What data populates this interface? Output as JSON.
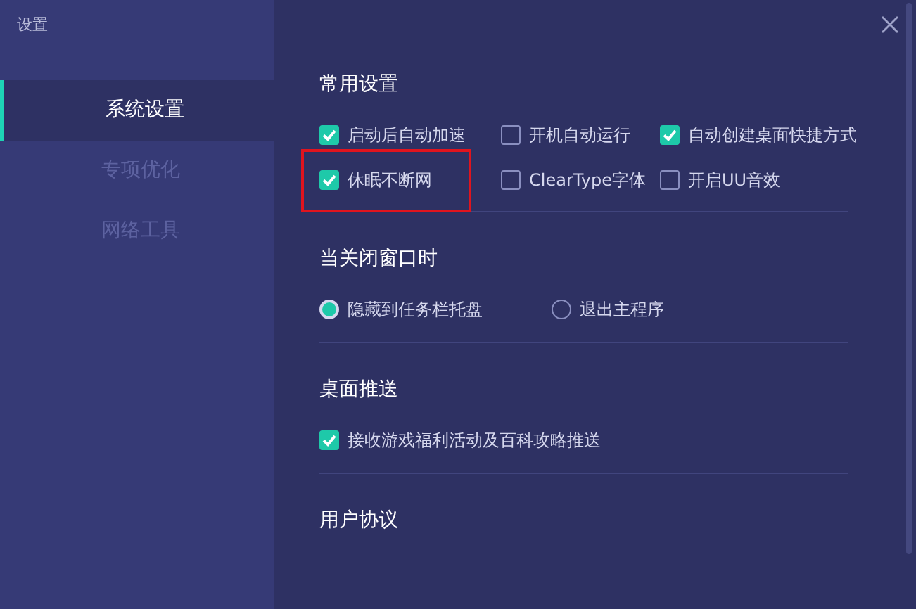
{
  "window": {
    "title": "设置"
  },
  "sidebar": {
    "items": [
      {
        "label": "系统设置",
        "selected": true
      },
      {
        "label": "专项优化",
        "selected": false
      },
      {
        "label": "网络工具",
        "selected": false
      }
    ]
  },
  "sections": [
    {
      "title": "常用设置",
      "kind": "checkboxes",
      "options": [
        {
          "label": "启动后自动加速",
          "checked": true,
          "highlighted": false
        },
        {
          "label": "开机自动运行",
          "checked": false,
          "highlighted": false
        },
        {
          "label": "自动创建桌面快捷方式",
          "checked": true,
          "highlighted": false
        },
        {
          "label": "休眠不断网",
          "checked": true,
          "highlighted": true
        },
        {
          "label": "ClearType字体",
          "checked": false,
          "highlighted": false
        },
        {
          "label": "开启UU音效",
          "checked": false,
          "highlighted": false
        }
      ]
    },
    {
      "title": "当关闭窗口时",
      "kind": "radios",
      "options": [
        {
          "label": "隐藏到任务栏托盘",
          "selected": true
        },
        {
          "label": "退出主程序",
          "selected": false
        }
      ]
    },
    {
      "title": "桌面推送",
      "kind": "checkboxes",
      "options": [
        {
          "label": "接收游戏福利活动及百科攻略推送",
          "checked": true,
          "highlighted": false
        }
      ]
    },
    {
      "title": "用户协议",
      "kind": "text"
    }
  ]
}
